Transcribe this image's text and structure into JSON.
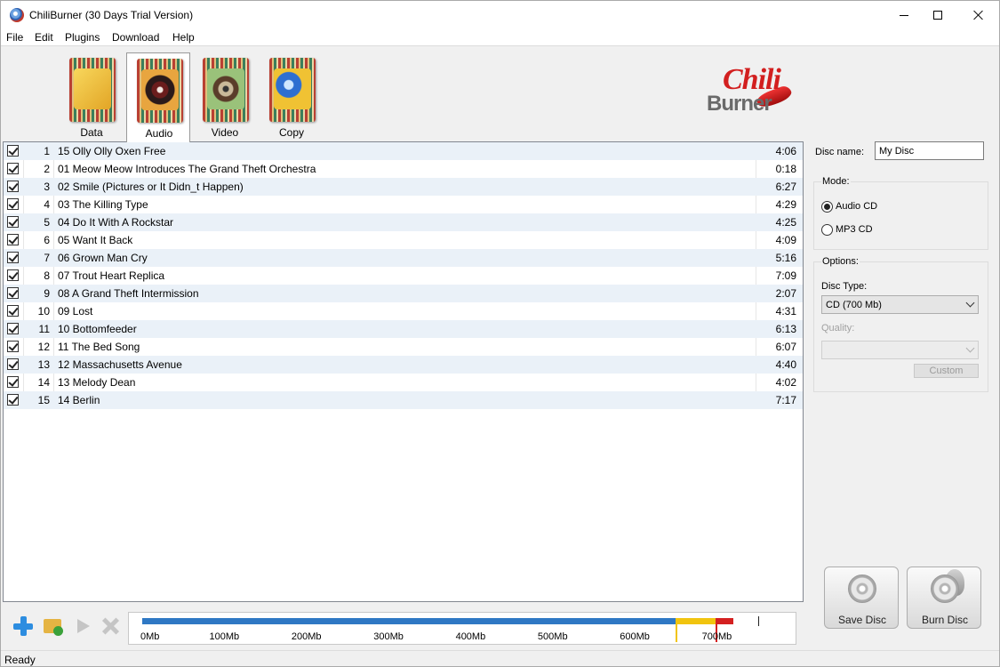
{
  "window": {
    "title": "ChiliBurner (30 Days Trial Version)"
  },
  "menu": [
    "File",
    "Edit",
    "Plugins",
    "Download",
    "Help"
  ],
  "tabs": [
    {
      "label": "Data",
      "icon": "data-icon",
      "active": false
    },
    {
      "label": "Audio",
      "icon": "audio-icon",
      "active": true
    },
    {
      "label": "Video",
      "icon": "video-icon",
      "active": false
    },
    {
      "label": "Copy",
      "icon": "copy-icon",
      "active": false
    }
  ],
  "logo": {
    "line1": "Chili",
    "line2": "Burner"
  },
  "tracks": [
    {
      "checked": true,
      "num": "1",
      "name": "15 Olly Olly Oxen Free",
      "duration": "4:06"
    },
    {
      "checked": true,
      "num": "2",
      "name": "01 Meow Meow Introduces The Grand Theft Orchestra",
      "duration": "0:18"
    },
    {
      "checked": true,
      "num": "3",
      "name": "02 Smile (Pictures or It Didn_t Happen)",
      "duration": "6:27"
    },
    {
      "checked": true,
      "num": "4",
      "name": "03 The Killing Type",
      "duration": "4:29"
    },
    {
      "checked": true,
      "num": "5",
      "name": "04 Do It With A Rockstar",
      "duration": "4:25"
    },
    {
      "checked": true,
      "num": "6",
      "name": "05 Want It Back",
      "duration": "4:09"
    },
    {
      "checked": true,
      "num": "7",
      "name": "06 Grown Man Cry",
      "duration": "5:16"
    },
    {
      "checked": true,
      "num": "8",
      "name": "07 Trout Heart Replica",
      "duration": "7:09"
    },
    {
      "checked": true,
      "num": "9",
      "name": "08 A Grand Theft Intermission",
      "duration": "2:07"
    },
    {
      "checked": true,
      "num": "10",
      "name": "09 Lost",
      "duration": "4:31"
    },
    {
      "checked": true,
      "num": "11",
      "name": "10 Bottomfeeder",
      "duration": "6:13"
    },
    {
      "checked": true,
      "num": "12",
      "name": "11 The Bed Song",
      "duration": "6:07"
    },
    {
      "checked": true,
      "num": "13",
      "name": "12 Massachusetts Avenue",
      "duration": "4:40"
    },
    {
      "checked": true,
      "num": "14",
      "name": "13 Melody Dean",
      "duration": "4:02"
    },
    {
      "checked": true,
      "num": "15",
      "name": "14 Berlin",
      "duration": "7:17"
    }
  ],
  "panel": {
    "disc_name_label": "Disc name:",
    "disc_name_value": "My Disc",
    "mode_label": "Mode:",
    "mode_audio": "Audio CD",
    "mode_mp3": "MP3 CD",
    "mode_selected": "Audio CD",
    "options_label": "Options:",
    "disc_type_label": "Disc Type:",
    "disc_type_value": "CD (700 Mb)",
    "quality_label": "Quality:",
    "quality_value": "",
    "custom_label": "Custom"
  },
  "actions": {
    "save_disc": "Save Disc",
    "burn_disc": "Burn Disc"
  },
  "toolbar": {
    "icons": [
      "add-icon",
      "add-folder-icon",
      "play-icon",
      "delete-icon"
    ]
  },
  "meter": {
    "scale_labels": [
      "0Mb",
      "100Mb",
      "200Mb",
      "300Mb",
      "400Mb",
      "500Mb",
      "600Mb",
      "700Mb"
    ],
    "scale_max_mb": 750,
    "used_mb": 720,
    "warning_mb": 650,
    "limit_mb": 700,
    "colors": {
      "normal": "#2f78c4",
      "warning": "#f1c40f",
      "over": "#d42020"
    }
  },
  "status": "Ready"
}
